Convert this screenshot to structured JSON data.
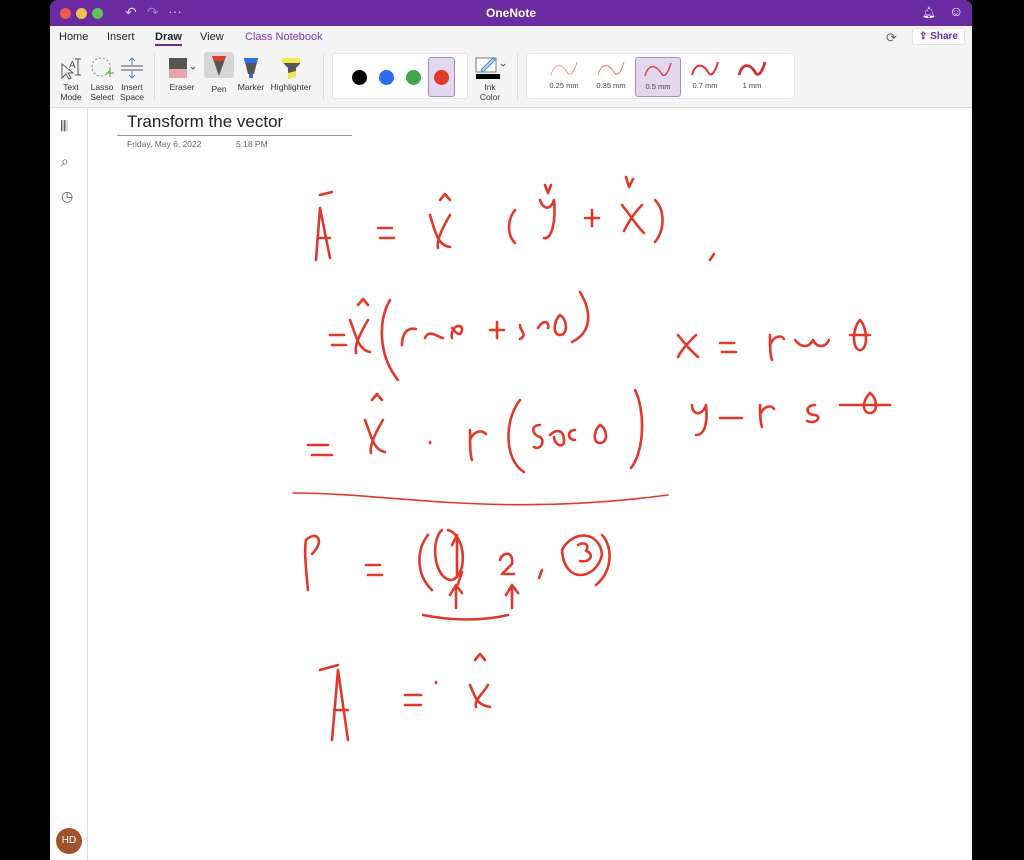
{
  "window": {
    "title": "OneNote"
  },
  "titlebar": {
    "icons": [
      "undo-icon",
      "redo-icon",
      "more-icon",
      "bell-icon",
      "smiley-icon"
    ],
    "more": "···"
  },
  "tabs": [
    {
      "label": "Home"
    },
    {
      "label": "Insert"
    },
    {
      "label": "Draw",
      "active": true
    },
    {
      "label": "View"
    },
    {
      "label": "Class Notebook"
    }
  ],
  "share_label": "Share",
  "ribbon": {
    "tools": [
      {
        "line1": "Text",
        "line2": "Mode"
      },
      {
        "line1": "Lasso",
        "line2": "Select"
      },
      {
        "line1": "Insert",
        "line2": "Space"
      }
    ],
    "pens": [
      {
        "label": "Eraser"
      },
      {
        "label": "Pen",
        "selected": true
      },
      {
        "label": "Marker"
      },
      {
        "label": "Highlighter"
      }
    ],
    "colors": [
      "#000000",
      "#2c6cf0",
      "#3da84a",
      "#e0392b"
    ],
    "selected_color": "#e0392b",
    "ink_color": {
      "line1": "Ink",
      "line2": "Color"
    },
    "widths": [
      "0.25 mm",
      "0.35 mm",
      "0.5 mm",
      "0.7 mm",
      "1 mm"
    ],
    "selected_width": "0.5 mm"
  },
  "avatar": "HD",
  "page": {
    "title": "Transform the vector",
    "date": "Friday, May 6, 2022",
    "time": "5:18 PM"
  },
  "ink_color": "#e0392b"
}
